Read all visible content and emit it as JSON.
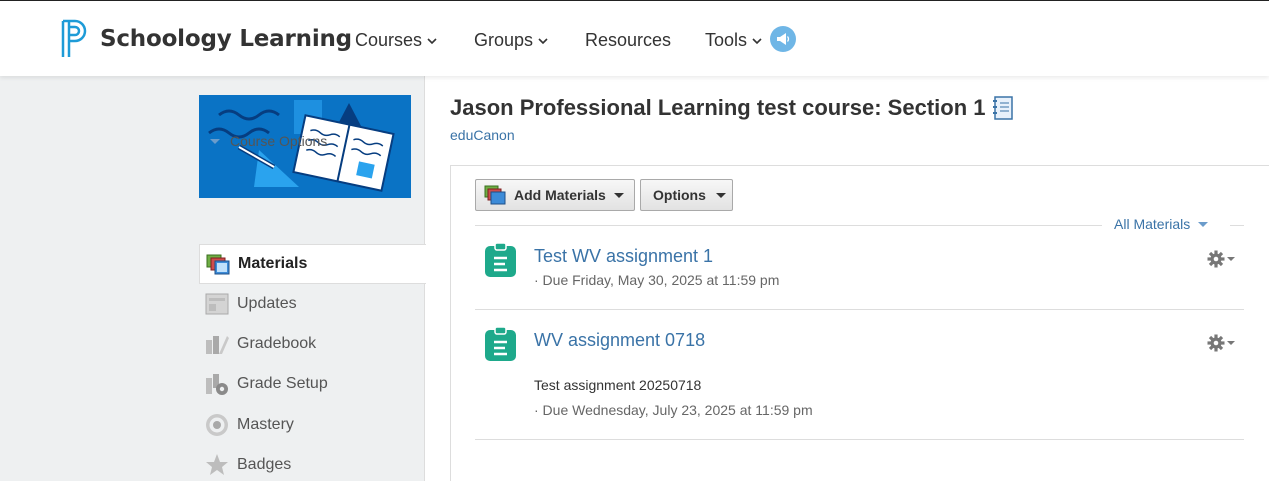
{
  "header": {
    "brand": "Schoology Learning",
    "nav": [
      {
        "label": "Courses",
        "has_dropdown": true
      },
      {
        "label": "Groups",
        "has_dropdown": true
      },
      {
        "label": "Resources",
        "has_dropdown": false
      },
      {
        "label": "Tools",
        "has_dropdown": true
      }
    ],
    "announce_icon": "megaphone-icon"
  },
  "sidebar": {
    "course_options": "Course Options",
    "items": [
      {
        "label": "Materials",
        "icon": "materials-icon",
        "active": true
      },
      {
        "label": "Updates",
        "icon": "updates-icon",
        "active": false
      },
      {
        "label": "Gradebook",
        "icon": "gradebook-icon",
        "active": false
      },
      {
        "label": "Grade Setup",
        "icon": "grade-setup-icon",
        "active": false
      },
      {
        "label": "Mastery",
        "icon": "mastery-icon",
        "active": false
      },
      {
        "label": "Badges",
        "icon": "badges-icon",
        "active": false
      }
    ]
  },
  "course": {
    "title": "Jason Professional Learning test course: Section 1",
    "subtitle": "eduCanon"
  },
  "toolbar": {
    "add_materials": "Add Materials",
    "options": "Options",
    "filter": "All Materials"
  },
  "materials": [
    {
      "title": "Test WV assignment 1",
      "description": "",
      "due": "· Due Friday, May 30, 2025 at 11:59 pm"
    },
    {
      "title": "WV assignment 0718",
      "description": "Test assignment 20250718",
      "due": "· Due Wednesday, July 23, 2025 at 11:59 pm"
    }
  ],
  "colors": {
    "link": "#3a73a7",
    "assignment_icon": "#1ea98b",
    "banner": "#0a73c5"
  }
}
